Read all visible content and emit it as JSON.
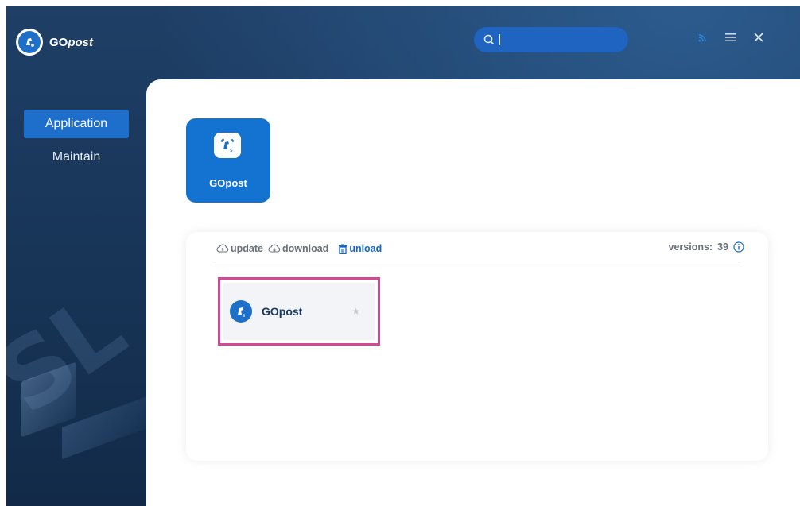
{
  "app": {
    "brand_prefix": "GO",
    "brand_suffix": "post"
  },
  "search": {
    "placeholder": "",
    "value": ""
  },
  "topbar": {
    "icons": [
      "rss-icon",
      "menu-icon",
      "close-icon"
    ]
  },
  "sidebar": {
    "items": [
      {
        "label": "Application",
        "active": true
      },
      {
        "label": "Maintain",
        "active": false
      }
    ]
  },
  "main": {
    "app_tile": {
      "label": "GOpost"
    },
    "toolbar": {
      "update_label": "update",
      "download_label": "download",
      "unload_label": "unload",
      "versions_label": "versions:",
      "versions_count": "39"
    },
    "items": [
      {
        "name": "GOpost",
        "starred": false
      }
    ]
  },
  "colors": {
    "accent": "#1473d0",
    "highlight": "#d14a92",
    "unload": "#1766c4"
  }
}
